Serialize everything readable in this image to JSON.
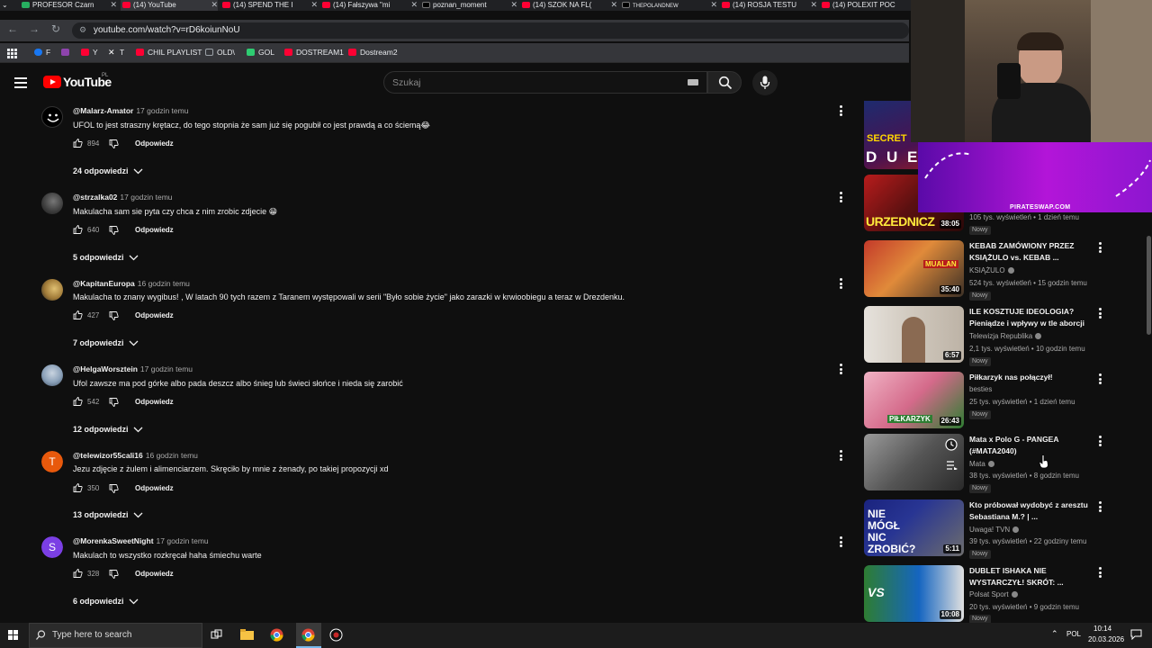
{
  "browser": {
    "tabs": [
      {
        "label": "PROFESOR Czarn"
      },
      {
        "label": "(14) YouTube"
      },
      {
        "label": "(14) SPEND THE I"
      },
      {
        "label": "(14) Fałszywa \"mi"
      },
      {
        "label": "poznan_moment"
      },
      {
        "label": "(14) SZOK NA FL("
      },
      {
        "label": "THEPOLANDNEW"
      },
      {
        "label": "(14) ROSJA TESTU"
      },
      {
        "label": "(14) POLEXIT POC"
      }
    ],
    "url": "youtube.com/watch?v=rD6koiunNoU",
    "bookmarks": [
      {
        "label": "F",
        "color": "#1877f2"
      },
      {
        "label": "",
        "color": "#8e44ad"
      },
      {
        "label": "Y",
        "color": "#ff0033"
      },
      {
        "label": "T",
        "color": "#ffffff"
      },
      {
        "label": "CHIL PLAYLIST",
        "color": "#ff0033"
      },
      {
        "label": "OLD\\",
        "color": "#9aa0a6"
      },
      {
        "label": "GOL",
        "color": "#2ecc71"
      },
      {
        "label": "DOSTREAM1",
        "color": "#ff0033"
      },
      {
        "label": "Dostream2",
        "color": "#ff0033"
      }
    ]
  },
  "youtube": {
    "logo_text": "YouTube",
    "country": "PL",
    "search_placeholder": "Szukaj",
    "accent": "#ff0000"
  },
  "comments": [
    {
      "author": "@Malarz-Amator",
      "time": "17 godzin temu",
      "text": "UFOL to jest straszny krętacz, do tego stopnia że sam już się pogubił co jest prawdą a co ściemą😂",
      "likes": "894",
      "reply": "Odpowiedz",
      "replies": "24 odpowiedzi"
    },
    {
      "author": "@strzalka02",
      "time": "17 godzin temu",
      "text": "Makulacha sam sie pyta czy chca z nim zrobic zdjecie 😁",
      "likes": "640",
      "reply": "Odpowiedz",
      "replies": "5 odpowiedzi"
    },
    {
      "author": "@KapitanEuropa",
      "time": "16 godzin temu",
      "text": "Makulacha to znany wygibus! , W latach 90 tych razem z Taranem występowali w serii \"Było sobie życie\" jako zarazki w krwioobiegu a teraz w Drezdenku.",
      "likes": "427",
      "reply": "Odpowiedz",
      "replies": "7 odpowiedzi"
    },
    {
      "author": "@HelgaWorsztein",
      "time": "17 godzin temu",
      "text": "Ufol zawsze ma pod górke albo pada deszcz albo śnieg lub świeci słońce i nieda się zarobić",
      "likes": "542",
      "reply": "Odpowiedz",
      "replies": "12 odpowiedzi"
    },
    {
      "author": "@telewizor55cali16",
      "time": "16 godzin temu",
      "text": "Jezu zdjęcie z żulem i alimenciarzem. Skręciło by mnie z żenady, po takiej propozycji xd",
      "likes": "350",
      "reply": "Odpowiedz",
      "replies": "13 odpowiedzi",
      "avatar_letter": "T",
      "avatar_color": "#e8590c"
    },
    {
      "author": "@MorenkaSweetNight",
      "time": "17 godzin temu",
      "text": "Makulach to wszystko rozkręcał haha śmiechu warte",
      "likes": "328",
      "reply": "Odpowiedz",
      "replies": "6 odpowiedzi",
      "avatar_letter": "S",
      "avatar_color": "#7b3fe4"
    }
  ],
  "sidebar": {
    "videos": [
      {
        "title": "",
        "channel": "",
        "meta": "105 tys. wyświetleń • 1 dzień temu",
        "badge": "Nowy",
        "duration": "38:05",
        "thumb_text": "URZEDNICZ"
      },
      {
        "title": "KEBAB ZAMÓWIONY PRZEZ KSIĄŻULO vs. KEBAB ...",
        "channel": "KSIĄŻULO",
        "meta": "524 tys. wyświetleń • 15 godzin temu",
        "badge": "Nowy",
        "duration": "35:40",
        "thumb_text": "MUALAN"
      },
      {
        "title": "ILE KOSZTUJE IDEOLOGIA? Pieniądze i wpływy w tle aborcji",
        "channel": "Telewizja Republika",
        "meta": "2,1 tys. wyświetleń • 10 godzin temu",
        "badge": "Nowy",
        "duration": "6:57",
        "thumb_text": ""
      },
      {
        "title": "Piłkarzyk nas połączył!",
        "channel": "besties",
        "meta": "25 tys. wyświetleń • 1 dzień temu",
        "badge": "Nowy",
        "duration": "26:43",
        "thumb_text": "PIŁKARZYK"
      },
      {
        "title": "Mata x Polo G - PANGEA (#MATA2040)",
        "channel": "Mata",
        "meta": "38 tys. wyświetleń • 8 godzin temu",
        "badge": "Nowy",
        "duration": "",
        "thumb_text": ""
      },
      {
        "title": "Kto próbował wydobyć z aresztu Sebastiana M.? | ...",
        "channel": "Uwaga! TVN",
        "meta": "39 tys. wyświetleń • 22 godziny temu",
        "badge": "Nowy",
        "duration": "5:11",
        "thumb_text": "NIE MÓGŁ NIC ZROBIĆ?"
      },
      {
        "title": "DUBLET ISHAKA NIE WYSTARCZYŁ! SKRÓT: ...",
        "channel": "Polsat Sport",
        "meta": "20 tys. wyświetleń • 9 godzin temu",
        "badge": "Nowy",
        "duration": "10:08",
        "thumb_text": "VS"
      }
    ]
  },
  "overlay": {
    "label": "PIRATESWAP.COM",
    "secret_text": "SECRET",
    "dude_text": "D U E"
  },
  "taskbar": {
    "search_placeholder": "Type here to search",
    "language": "POL",
    "time": "10:14",
    "date": "20.03.2026"
  }
}
